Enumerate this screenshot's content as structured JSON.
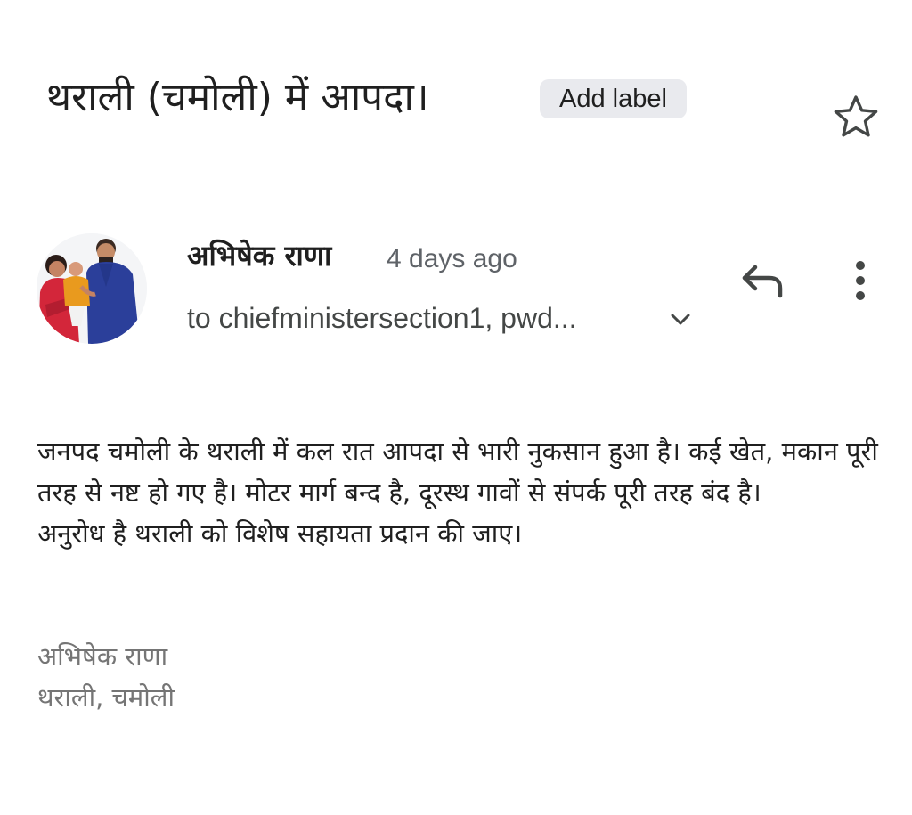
{
  "email": {
    "subject": "थराली (चमोली) में आपदा।",
    "label_chip": "Add label",
    "star_icon": "star-outline-icon",
    "sender": {
      "name": "अभिषेक राणा",
      "time": "4 days ago",
      "recipients": "to chiefministersection1, pwd...",
      "avatar": "family-photo-avatar"
    },
    "actions": {
      "reply_icon": "reply-icon",
      "more_icon": "more-vert-icon",
      "expand_icon": "chevron-down-icon"
    },
    "body": {
      "paragraph1": "जनपद चमोली के थराली में कल रात आपदा से भारी नुकसान हुआ है। कई खेत, मकान पूरी तरह से नष्ट हो गए है। मोटर मार्ग बन्द है, दूरस्थ गावों से संपर्क पूरी तरह बंद है।",
      "paragraph2": "अनुरोध है थराली को विशेष सहायता प्रदान की जाए।"
    },
    "signature": {
      "line1": "अभिषेक राणा",
      "line2": "थराली, चमोली"
    }
  },
  "colors": {
    "text": "#1f1f1f",
    "secondary": "#5f6368",
    "signature": "#757575",
    "chip_bg": "#e9eaee"
  }
}
